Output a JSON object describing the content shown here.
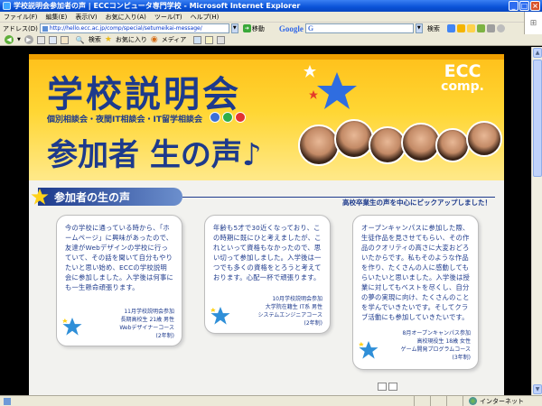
{
  "window": {
    "title": "学校説明会参加者の声 | ECCコンピュータ専門学校 - Microsoft Internet Explorer"
  },
  "menu": [
    "ファイル(F)",
    "編集(E)",
    "表示(V)",
    "お気に入り(A)",
    "ツール(T)",
    "ヘルプ(H)"
  ],
  "address": {
    "label": "アドレス(D)",
    "url": "http://hello.ecc.ac.jp/comp/special/setumeikai-message/",
    "go_label": "移動"
  },
  "google": {
    "logo": "Google",
    "search_label": "検索"
  },
  "toolbar": {
    "search_label": "検索",
    "favorites_label": "お気に入り",
    "media_label": "メディア"
  },
  "banner": {
    "title": "学校説明会",
    "subtitle": "個別相談会・夜間IT相談会・IT留学相談会",
    "title2": "参加者 生の声♪",
    "logo_line1": "ECC",
    "logo_line2": "comp."
  },
  "section": {
    "title": "参加者の生の声",
    "subtitle": "高校卒業生の声を中心にピックアップしました！"
  },
  "cards": [
    {
      "text": "今の学校に通っている時から、「ホームページ」に興味があったので、友達がWebデザインの学校に行っていて、その話を聞いて自分もやりたいと思い始め、ECCの学校説明会に参加しました。入学後は何事にも一生懸命頑張ります。",
      "attribution": [
        "11月学校説明会参加",
        "長期高校生 21歳 男性",
        "Webデザイナーコース",
        "(2年制)"
      ]
    },
    {
      "text": "年齢も5才で30近くなっており、この時期に既にひと考えましたが、これといって資格もなかったので、思い切って参加しました。入学後は一つでも多くの資格をとろうと考えております。心配一杯で頑張ります。",
      "attribution": [
        "10月学校説明会参加",
        "大学院在籍生 IT系 男性",
        "システムエンジニアコース",
        "(2年制)"
      ]
    },
    {
      "text": "オープンキャンパスに参加した際、生徒作品を見させてもらい、その作品のクオリティの高さに大変おどろいたからです。私もそのような作品を作り、たくさんの人に感動してもらいたいと思いました。入学後は授業に対してもベストを尽くし、自分の夢の実現に向け、たくさんのことを学んでいきたいです。そしてクラブ活動にも参加していきたいです。",
      "attribution": [
        "8月オープンキャンパス参加",
        "高校現役生 18歳 女性",
        "ゲーム開発プログラムコース",
        "(3年制)"
      ]
    }
  ],
  "status": {
    "zone": "インターネット"
  },
  "colors": {
    "navy": "#1d3a8c",
    "banner_orange": "#ffc01a",
    "xp_blue": "#0a52d8"
  }
}
